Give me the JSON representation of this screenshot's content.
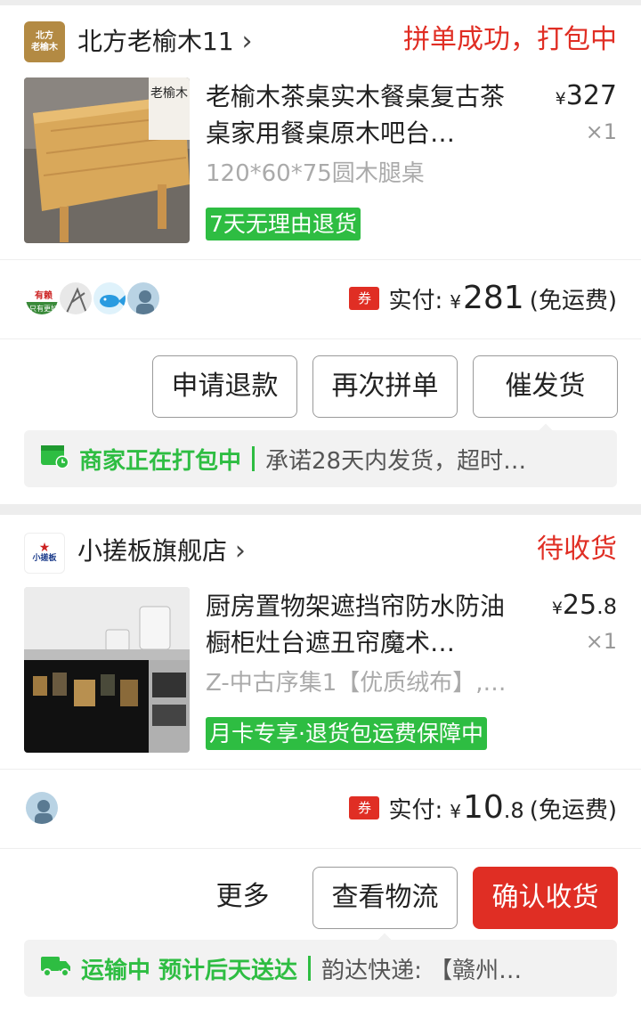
{
  "orders": [
    {
      "shop_logo_text": [
        "北方",
        "老榆木"
      ],
      "shop_name": "北方老榆木11",
      "status": "拼单成功，打包中",
      "product_title": "老榆木茶桌实木餐桌复古茶桌家用餐桌原木吧台…",
      "product_image_text": "老榆木",
      "price_symbol": "¥",
      "price": "327",
      "quantity": "×1",
      "sku": "120*60*75圆木腿桌",
      "promo_tag": "7天无理由退货",
      "coupon_label": "券",
      "paid_label": "实付:",
      "paid_symbol": "¥",
      "paid_amount": "281",
      "paid_decimal": "",
      "shipping_note": "(免运费)",
      "buttons": [
        "申请退款",
        "再次拼单",
        "催发货"
      ],
      "logistics_status": "商家正在打包中",
      "logistics_detail": "承诺28天内发货，超时…",
      "avatars": [
        "有赖 只有更好",
        "sketch",
        "fish",
        "user"
      ]
    },
    {
      "shop_logo_text": [
        "小搓板"
      ],
      "shop_name": "小搓板旗舰店",
      "status": "待收货",
      "product_title": "厨房置物架遮挡帘防水防油橱柜灶台遮丑帘魔术…",
      "price_symbol": "¥",
      "price": "25",
      "price_decimal": ".8",
      "quantity": "×1",
      "sku": "Z-中古序集1【优质绒布】,…",
      "promo_tag": "月卡专享·退货包运费保障中",
      "coupon_label": "券",
      "paid_label": "实付:",
      "paid_symbol": "¥",
      "paid_amount": "10",
      "paid_decimal": ".8",
      "shipping_note": "(免运费)",
      "buttons": [
        "更多",
        "查看物流",
        "确认收货"
      ],
      "logistics_status": "运输中 预计后天送达",
      "logistics_detail": "韵达快递: 【赣州…",
      "avatars": [
        "user"
      ]
    }
  ],
  "colors": {
    "red": "#e02e24",
    "green": "#2ebd42",
    "background": "#ededed"
  }
}
